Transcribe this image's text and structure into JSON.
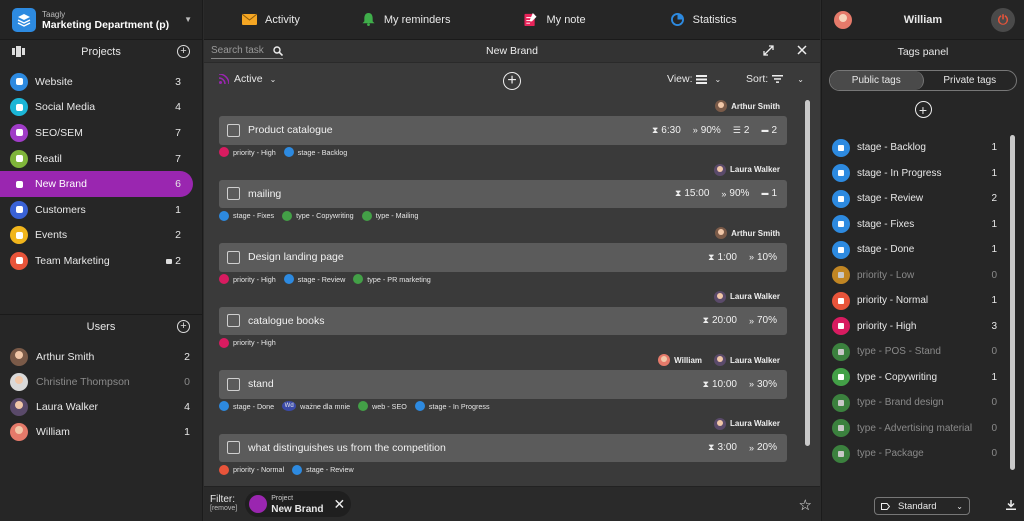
{
  "org": {
    "app": "Taagly",
    "name": "Marketing Department (p)"
  },
  "projects": {
    "title": "Projects",
    "items": [
      {
        "label": "Website",
        "count": "3",
        "color": "#2d8ae0"
      },
      {
        "label": "Social Media",
        "count": "4",
        "color": "#1bb5d6"
      },
      {
        "label": "SEO/SEM",
        "count": "7",
        "color": "#a03cc7"
      },
      {
        "label": "Reatil",
        "count": "7",
        "color": "#7fb53a"
      },
      {
        "label": "New Brand",
        "count": "6",
        "color": "#9a26b0",
        "active": true
      },
      {
        "label": "Customers",
        "count": "1",
        "color": "#3a62d6"
      },
      {
        "label": "Events",
        "count": "2",
        "color": "#f1b51c"
      },
      {
        "label": "Team Marketing",
        "count": "2",
        "color": "#e8543a",
        "locked": true
      }
    ]
  },
  "users": {
    "title": "Users",
    "items": [
      {
        "name": "Arthur Smith",
        "count": "2",
        "color": "#7a5a48"
      },
      {
        "name": "Christine Thompson",
        "count": "0",
        "color": "#d9d9d9",
        "dim": true
      },
      {
        "name": "Laura Walker",
        "count": "4",
        "color": "#5a4a6a"
      },
      {
        "name": "William",
        "count": "1",
        "color": "#e57a6a"
      }
    ]
  },
  "topnav": {
    "activity": "Activity",
    "reminders": "My reminders",
    "note": "My note",
    "statistics": "Statistics"
  },
  "subbar": {
    "search_placeholder": "Search task",
    "title": "New Brand"
  },
  "toolbar": {
    "status": "Active",
    "view": "View:",
    "sort": "Sort:"
  },
  "tasks": [
    {
      "assignee": "Arthur Smith",
      "title": "Product catalogue",
      "time": "6:30",
      "progress": "90%",
      "subtasks": "2",
      "comments": "2",
      "tags": [
        {
          "label": "priority - High",
          "color": "#d81b60"
        },
        {
          "label": "stage - Backlog",
          "color": "#2d8ae0"
        }
      ]
    },
    {
      "assignee": "Laura Walker",
      "title": "mailing",
      "time": "15:00",
      "progress": "90%",
      "comments": "1",
      "tags": [
        {
          "label": "stage - Fixes",
          "color": "#2d8ae0"
        },
        {
          "label": "type - Copywriting",
          "color": "#43a047"
        },
        {
          "label": "type - Mailing",
          "color": "#43a047"
        }
      ]
    },
    {
      "assignee": "Arthur Smith",
      "title": "Design landing page",
      "time": "1:00",
      "progress": "10%",
      "tags": [
        {
          "label": "priority - High",
          "color": "#d81b60"
        },
        {
          "label": "stage - Review",
          "color": "#2d8ae0"
        },
        {
          "label": "type - PR marketing",
          "color": "#43a047"
        }
      ]
    },
    {
      "assignee": "Laura Walker",
      "title": "catalogue books",
      "time": "20:00",
      "progress": "70%",
      "tags": [
        {
          "label": "priority - High",
          "color": "#d81b60"
        }
      ]
    },
    {
      "assignee": "Laura Walker",
      "extra_assignee": "William",
      "title": "stand",
      "time": "10:00",
      "progress": "30%",
      "tags": [
        {
          "label": "stage - Done",
          "color": "#2d8ae0"
        },
        {
          "label": "ważne dla mnie",
          "color": "#3a4aa8",
          "text": "Wd"
        },
        {
          "label": "web - SEO",
          "color": "#43a047"
        },
        {
          "label": "stage - In Progress",
          "color": "#2d8ae0"
        }
      ]
    },
    {
      "assignee": "Laura Walker",
      "title": "what distinguishes us from the competition",
      "time": "3:00",
      "progress": "20%",
      "tags": [
        {
          "label": "priority - Normal",
          "color": "#e8543a"
        },
        {
          "label": "stage - Review",
          "color": "#2d8ae0"
        }
      ]
    }
  ],
  "footer": {
    "filter": "Filter:",
    "remove": "[remove]",
    "chip_kind": "Project",
    "chip_name": "New Brand"
  },
  "user_header": {
    "name": "William"
  },
  "tags_panel": {
    "title": "Tags panel",
    "public": "Public tags",
    "private": "Private tags",
    "items": [
      {
        "label": "stage - Backlog",
        "count": "1",
        "color": "#2d8ae0"
      },
      {
        "label": "stage - In Progress",
        "count": "1",
        "color": "#2d8ae0"
      },
      {
        "label": "stage - Review",
        "count": "2",
        "color": "#2d8ae0"
      },
      {
        "label": "stage - Fixes",
        "count": "1",
        "color": "#2d8ae0"
      },
      {
        "label": "stage - Done",
        "count": "1",
        "color": "#2d8ae0"
      },
      {
        "label": "priority - Low",
        "count": "0",
        "color": "#f5a623",
        "dim": true
      },
      {
        "label": "priority - Normal",
        "count": "1",
        "color": "#e8543a"
      },
      {
        "label": "priority - High",
        "count": "3",
        "color": "#d81b60"
      },
      {
        "label": "type - POS - Stand",
        "count": "0",
        "color": "#43a047",
        "dim": true
      },
      {
        "label": "type - Copywriting",
        "count": "1",
        "color": "#43a047"
      },
      {
        "label": "type - Brand design",
        "count": "0",
        "color": "#43a047",
        "dim": true
      },
      {
        "label": "type - Advertising material",
        "count": "0",
        "color": "#43a047",
        "dim": true
      },
      {
        "label": "type - Package",
        "count": "0",
        "color": "#43a047",
        "dim": true
      }
    ],
    "footer_select": "Standard"
  }
}
